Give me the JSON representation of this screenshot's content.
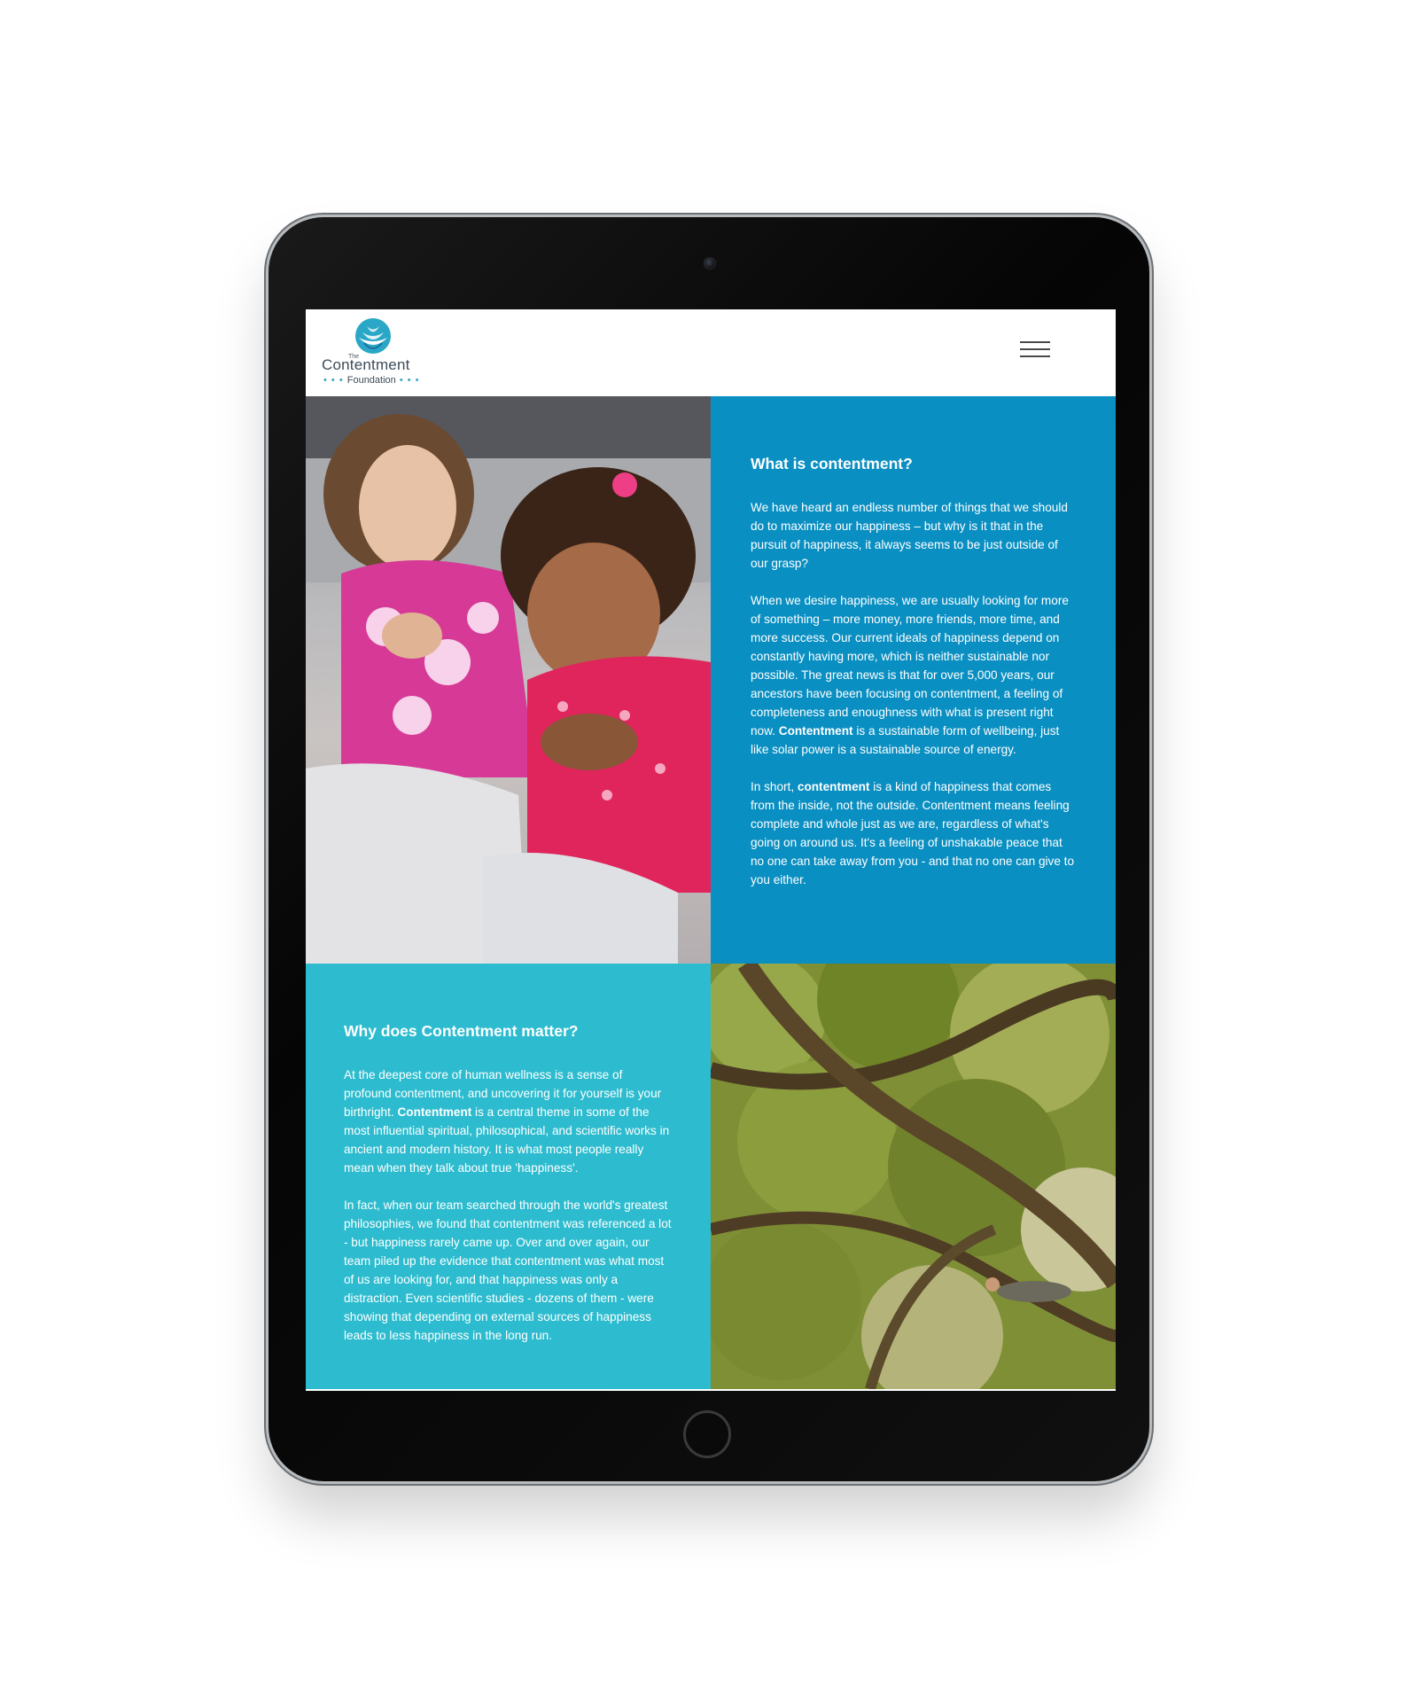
{
  "header": {
    "logo_the": "The",
    "logo_name": "Contentment",
    "logo_sub": "Foundation",
    "menu_icon": "hamburger-icon"
  },
  "section_what": {
    "title": "What is contentment?",
    "p1": "We have heard an endless number of things that we should do to maximize our happiness – but why is it that in the pursuit of happiness, it always seems to be just outside of our grasp?",
    "p2_before": "When we desire happiness, we are usually looking for more of something – more money, more friends, more time, and more success. Our current ideals of happiness depend on constantly having more, which is neither sustainable nor possible. The great news is that for over 5,000 years, our ancestors have been focusing on contentment, a feeling of completeness and enoughness with what is present right now. ",
    "p2_bold": "Contentment",
    "p2_after": " is a sustainable form of wellbeing, just like solar power is a sustainable source of energy.",
    "p3_before": "In short, ",
    "p3_bold": "contentment",
    "p3_after": " is a kind of happiness that comes from the inside, not the outside. Contentment means feeling complete and whole just as we are, regardless of what's going on around us. It's a feeling of unshakable peace that no one can take away from you - and that no one can give to you either."
  },
  "section_why": {
    "title": "Why does Contentment matter?",
    "p1_before": "At the deepest core of human wellness is a sense of profound contentment, and uncovering it for yourself is your birthright. ",
    "p1_bold": "Contentment",
    "p1_after": " is a central theme in some of the most influential spiritual, philosophical, and scientific works in ancient and modern history. It is what most people really mean when they talk about true 'happiness'.",
    "p2": "In fact, when our team searched through the world's greatest philosophies, we found that contentment was referenced a lot - but happiness rarely came up. Over and over again, our team piled up the evidence that contentment was what most of us are looking for, and that happiness was only a distraction. Even scientific studies - dozens of them - were showing that depending on external sources of happiness leads to less happiness in the long run."
  },
  "colors": {
    "blue_panel": "#0a8fc2",
    "teal_panel": "#2dbccf",
    "logo_accent": "#2aa7c6"
  }
}
